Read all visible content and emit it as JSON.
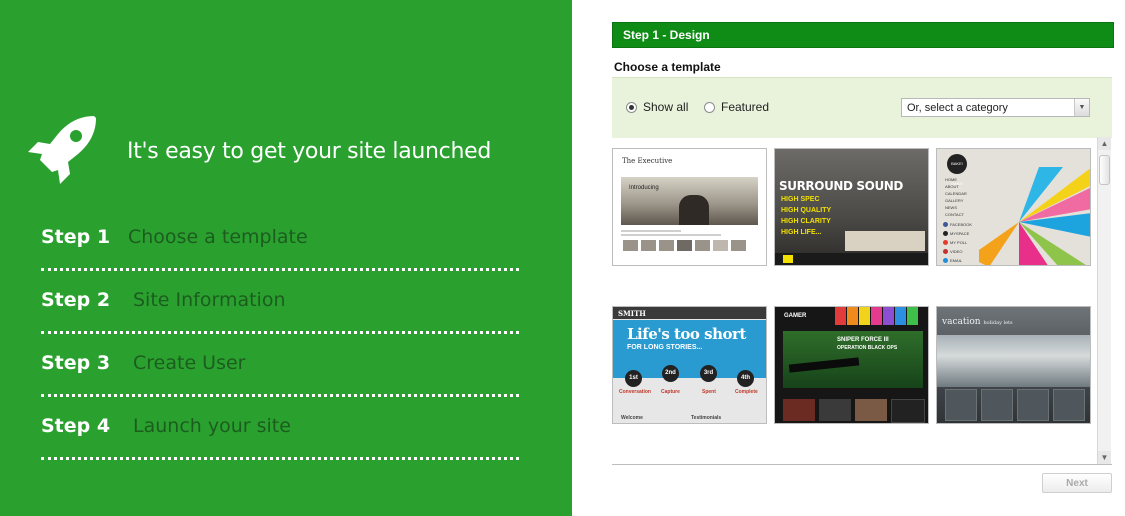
{
  "sidebar": {
    "headline": "It's easy to get your site launched",
    "steps": [
      {
        "number": "Step 1",
        "label": "Choose a template"
      },
      {
        "number": "Step 2",
        "label": "Site Information"
      },
      {
        "number": "Step 3",
        "label": "Create User"
      },
      {
        "number": "Step 4",
        "label": "Launch your site"
      }
    ],
    "colors": {
      "background": "#2aa12f",
      "step_label": "#1c5d1f"
    },
    "icon": "rocket-icon"
  },
  "wizard": {
    "section_title": "Step 1 - Design",
    "subtitle": "Choose a template",
    "filter": {
      "show_all_label": "Show all",
      "featured_label": "Featured",
      "selected": "Show all",
      "category_select": "Or, select a category"
    },
    "templates": [
      {
        "name": "The Executive",
        "thumb_text": "The Executive",
        "hero_text": "Introducing"
      },
      {
        "name": "Surround Sound",
        "thumb_text": "SURROUND SOUND",
        "features": [
          "HIGH SPEC",
          "HIGH QUALITY",
          "HIGH CLARITY",
          "HIGH LIFE..."
        ]
      },
      {
        "name": "Bake Oake",
        "thumb_text": "BAKE! OAKE!",
        "menu": [
          "HOME",
          "ABOUT",
          "CALENDAR",
          "GALLERY",
          "NEWS",
          "CONTACT"
        ],
        "social": [
          "FACEBOOK",
          "MYSPACE",
          "MY POLL",
          "VIDEO",
          "EMAIL"
        ]
      },
      {
        "name": "Smith",
        "thumb_text": "SMITH",
        "hero": "Life's too short",
        "hero_sub": "FOR LONG STORIES...",
        "steps": [
          "1st",
          "2nd",
          "3rd",
          "4th"
        ],
        "step_labels": [
          "Conversation",
          "Capture",
          "Spent",
          "Complete"
        ],
        "footer": [
          "Welcome",
          "Testimonials"
        ]
      },
      {
        "name": "Gamer",
        "thumb_text": "GAMER",
        "feature": "SNIPER FORCE III",
        "feature_sub": "OPERATION BLACK OPS"
      },
      {
        "name": "Vacation",
        "thumb_text": "vacation",
        "tagline": "holiday lets"
      }
    ],
    "next_button": "Next",
    "colors": {
      "bar": "#0e8c15",
      "filter_bg": "#e9f3dc"
    }
  }
}
